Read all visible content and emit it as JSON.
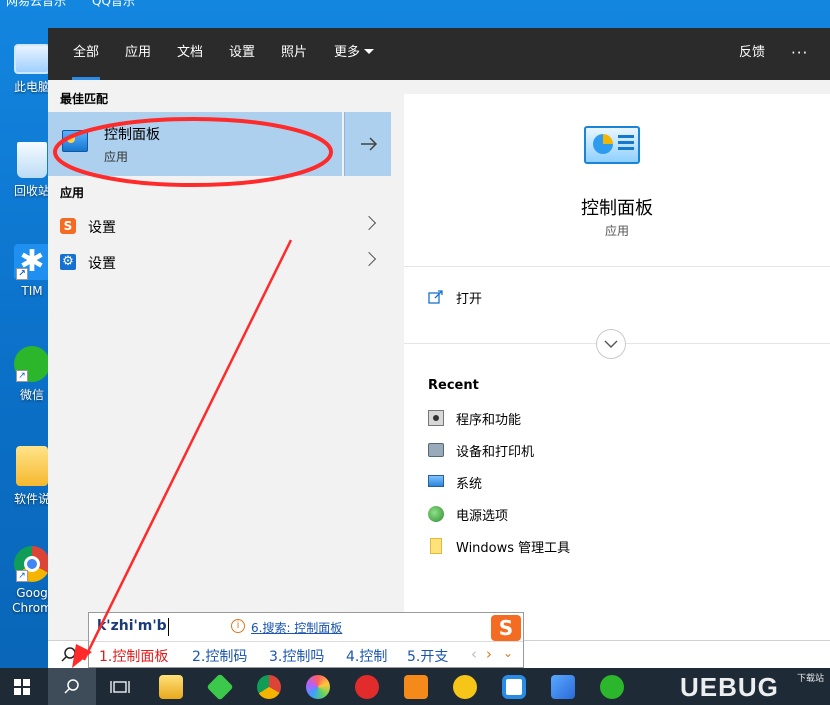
{
  "desktop": {
    "top_strip": [
      "网易云音乐",
      "QQ音乐"
    ],
    "icons": [
      {
        "label": "此电脑"
      },
      {
        "label": "回收站"
      },
      {
        "label": "TIM"
      },
      {
        "label": "微信"
      },
      {
        "label": "软件说"
      },
      {
        "label": "Goog Chrom"
      }
    ]
  },
  "search_panel": {
    "tabs": [
      "全部",
      "应用",
      "文档",
      "设置",
      "照片",
      "更多"
    ],
    "feedback": "反馈",
    "more_menu": "···",
    "best_match_header": "最佳匹配",
    "best_match": {
      "title": "控制面板",
      "subtitle": "应用"
    },
    "apps_header": "应用",
    "apps": [
      {
        "label": "设置",
        "icon": "sogou-icon"
      },
      {
        "label": "设置",
        "icon": "gear-icon"
      }
    ],
    "detail": {
      "title": "控制面板",
      "subtitle": "应用",
      "open_label": "打开",
      "recent_header": "Recent",
      "recent": [
        "程序和功能",
        "设备和打印机",
        "系统",
        "电源选项",
        "Windows 管理工具"
      ]
    }
  },
  "ime": {
    "composition": "k'zhi'm'b",
    "hint": "6.搜索: 控制面板",
    "candidates": [
      "1.控制面板",
      "2.控制码",
      "3.控制吗",
      "4.控制",
      "5.开支"
    ]
  },
  "watermark": {
    "text": "UEBUG",
    "sub": "下载站"
  },
  "colors": {
    "accent": "#2a8be6",
    "selected": "#acd0ee",
    "annotation_red": "#ff2a2a"
  }
}
